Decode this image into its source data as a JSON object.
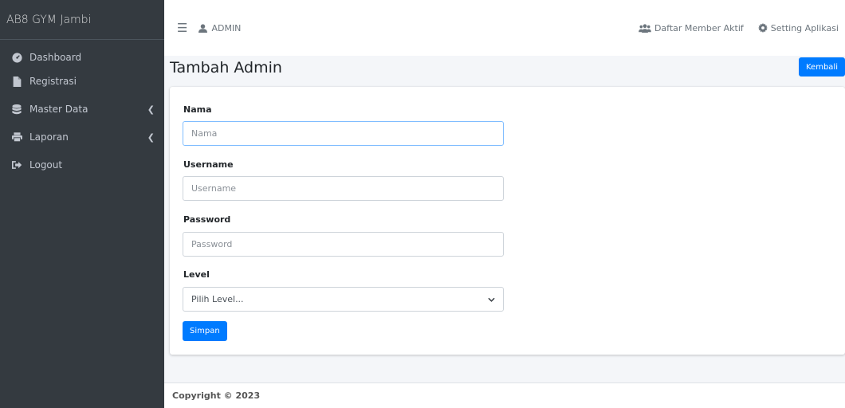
{
  "sidebar": {
    "brand": "AB8 GYM Jambi",
    "items": [
      {
        "label": "Dashboard",
        "icon": "tachometer-icon",
        "has_submenu": false
      },
      {
        "label": "Registrasi",
        "icon": "file-icon",
        "has_submenu": false
      },
      {
        "label": "Master Data",
        "icon": "database-icon",
        "has_submenu": true
      },
      {
        "label": "Laporan",
        "icon": "print-icon",
        "has_submenu": true
      },
      {
        "label": "Logout",
        "icon": "sign-out-icon",
        "has_submenu": false
      }
    ]
  },
  "topbar": {
    "user_label": "ADMIN",
    "links": [
      {
        "label": "Daftar Member Aktif",
        "icon": "users-icon"
      },
      {
        "label": "Setting Aplikasi",
        "icon": "cog-icon"
      }
    ]
  },
  "page": {
    "title": "Tambah Admin",
    "back_label": "Kembali"
  },
  "form": {
    "nama": {
      "label": "Nama",
      "placeholder": "Nama",
      "value": ""
    },
    "username": {
      "label": "Username",
      "placeholder": "Username",
      "value": ""
    },
    "password": {
      "label": "Password",
      "placeholder": "Password",
      "value": ""
    },
    "level": {
      "label": "Level",
      "selected": "Pilih Level..."
    },
    "submit_label": "Simpan"
  },
  "footer": {
    "copyright": "Copyright © 2023"
  },
  "colors": {
    "sidebar_bg": "#343a40",
    "primary": "#007bff",
    "content_bg": "#f4f6f9"
  }
}
